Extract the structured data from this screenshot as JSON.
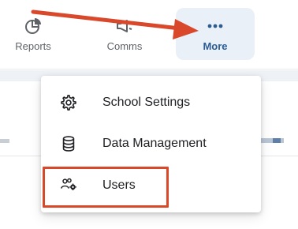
{
  "nav": {
    "reports_label": "Reports",
    "comms_label": "Comms",
    "more_label": "More"
  },
  "menu": {
    "items": [
      {
        "label": "School Settings",
        "icon": "gear-icon"
      },
      {
        "label": "Data Management",
        "icon": "database-icon"
      },
      {
        "label": "Users",
        "icon": "users-gear-icon"
      }
    ]
  },
  "colors": {
    "active_nav_bg": "#e9f0f7",
    "active_nav_text": "#2b5d93",
    "annotation": "#d9482b"
  }
}
